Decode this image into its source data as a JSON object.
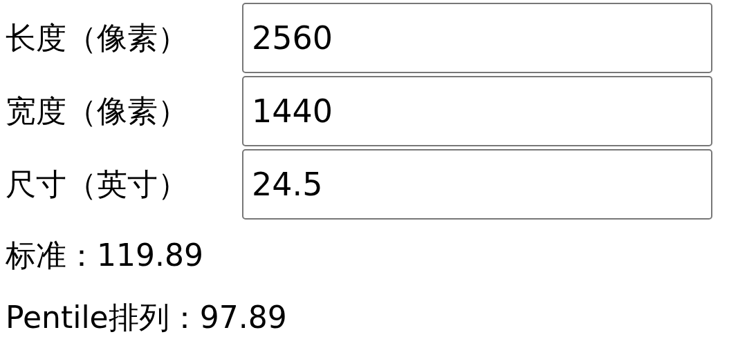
{
  "fields": [
    {
      "label": "长度（像素）",
      "value": "2560"
    },
    {
      "label": "宽度（像素）",
      "value": "1440"
    },
    {
      "label": "尺寸（英寸）",
      "value": "24.5"
    }
  ],
  "results": [
    "标准：119.89",
    "Pentile排列：97.89"
  ]
}
